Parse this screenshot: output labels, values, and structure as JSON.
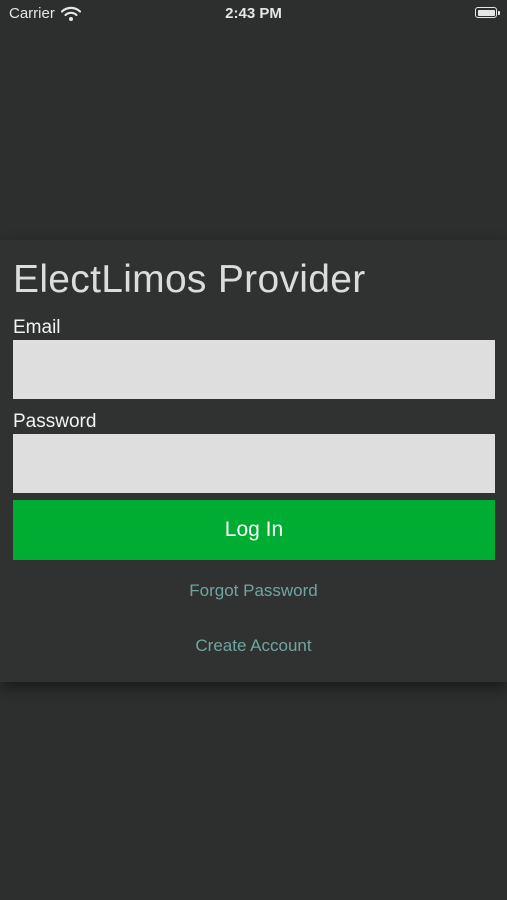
{
  "status_bar": {
    "carrier": "Carrier",
    "time": "2:43 PM",
    "wifi_icon": "wifi-icon",
    "battery_icon": "battery-icon"
  },
  "login": {
    "title": "ElectLimos Provider",
    "email_label": "Email",
    "email_value": "",
    "password_label": "Password",
    "password_value": "",
    "login_button": "Log In",
    "forgot_password": "Forgot Password",
    "create_account": "Create Account"
  },
  "colors": {
    "background": "#2d2e2e",
    "card": "#303232",
    "input": "#dedede",
    "accent_button": "#00ad33",
    "link": "#6fa5a0"
  }
}
